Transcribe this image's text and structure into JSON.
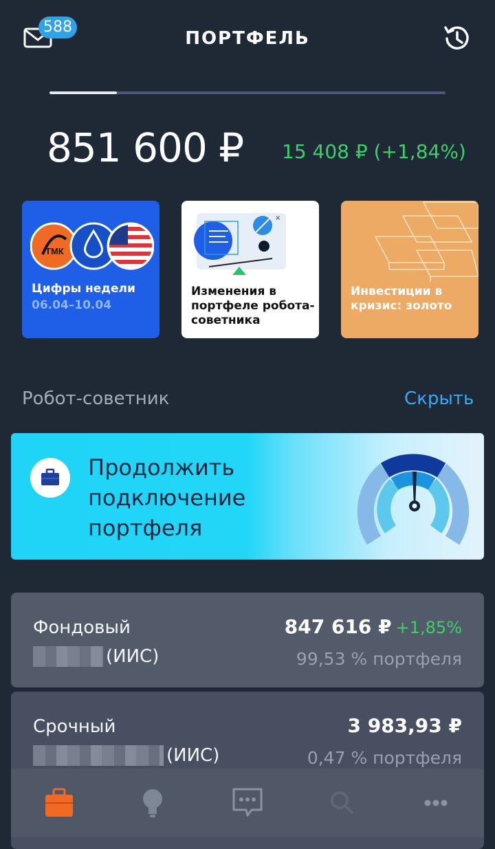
{
  "header": {
    "title": "ПОРТФЕЛЬ",
    "mail_badge": "588"
  },
  "stories_progress": 0.17,
  "portfolio": {
    "balance": "851 600 ₽",
    "change": "15 408 ₽ (+1,84%)"
  },
  "stories": [
    {
      "line1": "Цифры недели",
      "line2": "06.04–10.04",
      "logo_text": "ТМК"
    },
    {
      "line1": "Изменения в портфеле робота-советника"
    },
    {
      "line1": "Инвестиции в кризис: золото"
    }
  ],
  "robot_section": {
    "title": "Робот-советник",
    "hide_link": "Скрыть",
    "banner_text": "Продолжить подключение портфеля"
  },
  "accounts": [
    {
      "name": "Фондовый",
      "suffix": "(ИИС)",
      "amount": "847 616 ₽",
      "delta": "+1,85%",
      "share": "99,53 % портфеля"
    },
    {
      "name": "Срочный",
      "suffix": "(ИИС)",
      "amount": "3 983,93 ₽",
      "share": "0,47 % портфеля"
    }
  ],
  "tabbar": {
    "items": [
      "briefcase-icon",
      "lightbulb-icon",
      "chat-icon",
      "search-icon",
      "more-icon"
    ],
    "active_index": 0
  },
  "colors": {
    "background": "#1f2936",
    "accent": "#39aaf2",
    "positive": "#3ccf6a",
    "active_tab": "#f06a24"
  }
}
